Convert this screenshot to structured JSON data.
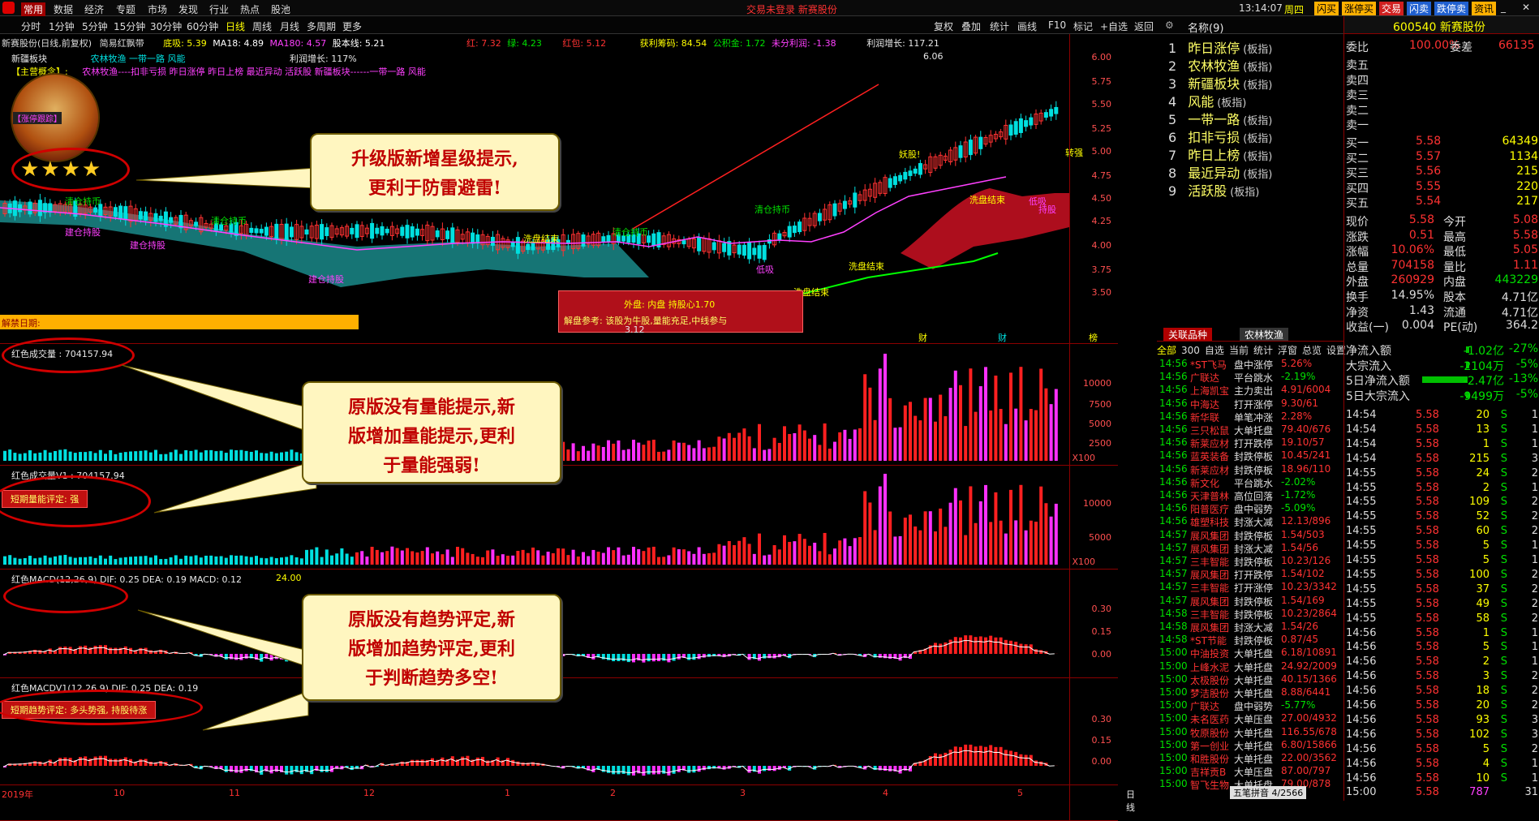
{
  "topbar": {
    "menu": [
      "常用",
      "数据",
      "经济",
      "专题",
      "市场",
      "发现",
      "行业",
      "热点",
      "股池"
    ],
    "center": "交易未登录   新赛股份",
    "time": "13:14:07",
    "weekday": "周四",
    "tabs": [
      "闪买",
      "涨停买",
      "交易",
      "闪卖",
      "跌停卖",
      "资讯"
    ]
  },
  "periods": {
    "items": [
      "分时",
      "1分钟",
      "5分钟",
      "15分钟",
      "30分钟",
      "60分钟",
      "日线",
      "周线",
      "月线",
      "多周期",
      "更多"
    ],
    "tools": [
      "复权",
      "叠加",
      "统计",
      "画线",
      "F10",
      "标记",
      "+自选",
      "返回"
    ]
  },
  "main": {
    "title": "新赛股份(日线,前复权)",
    "indicator": "简易红飘带",
    "ma": "MA18: 4.89",
    "ma180": "MA180: 4.57",
    "eq": "股本线: 5.21",
    "low": "底吸: 5.39",
    "red": "红: 7.32",
    "green": "绿: 4.23",
    "redpkg": "红包: 5.12",
    "chip": "获利筹码: 84.54",
    "gjj": "公积金: 1.72",
    "undist": "未分利润: -1.38",
    "profit": "利润增长: 117.21",
    "sector": "新疆板块",
    "concepts": "农林牧渔   一带一路 风能",
    "profit2": "利润增长:     117%",
    "main_concept": "【主营概念】:",
    "concept_line": "农林牧渔----扣非亏损 昨日涨停 昨日上榜 最近异动 活跃股 新疆板块------一带一路 风能",
    "zt": "【涨停跟踪】",
    "unlock": "解禁日期:",
    "yaxis": [
      "6.00",
      "5.75",
      "5.50",
      "5.25",
      "5.00",
      "4.75",
      "4.50",
      "4.25",
      "4.00",
      "3.75",
      "3.50"
    ],
    "peak": "6.06",
    "trough": "3.12",
    "inner": "外盘: 内盘    持股心1.70",
    "advice": "解盘参考: 该股为牛股,量能充足,中线参与",
    "labels": [
      "清仓持币",
      "清仓持币",
      "清仓持币",
      "清仓持币",
      "建仓持股",
      "建仓持股",
      "建仓持股",
      "洗盘结束",
      "洗盘结束",
      "洗盘结束",
      "洗盘结束",
      "妖股!",
      "转强",
      "持股",
      "低吸",
      "低吸"
    ],
    "markers": [
      "财",
      "财",
      "榜"
    ]
  },
  "vol1": {
    "title": "红色成交量 : 704157.94",
    "axis": [
      "10000",
      "7500",
      "5000",
      "2500"
    ],
    "unit": "X100"
  },
  "vol2": {
    "title": "红色成交量V1 : 704157.94",
    "tag": "短期量能评定: 强",
    "axis": [
      "10000",
      "5000"
    ],
    "unit": "X100"
  },
  "macd1": {
    "title": "红色MACD(12,26,9) DIF: 0.25  DEA: 0.19  MACD: 0.12",
    "extra": "24.00",
    "axis": [
      "0.30",
      "0.15",
      "0.00"
    ]
  },
  "macd2": {
    "title": "红色MACDV1(12,26,9) DIF: 0.25  DEA: 0.19",
    "tag": "短期趋势评定: 多头势强, 持股待涨",
    "axis": [
      "0.30",
      "0.15",
      "0.00"
    ]
  },
  "xaxis": [
    "2019年",
    "10",
    "11",
    "12",
    "1",
    "2",
    "3",
    "4",
    "5"
  ],
  "xaxis_end": "日线",
  "callouts": [
    "升级版新增星级提示,\n更利于防雷避雷!",
    "原版没有量能提示,新\n版增加量能提示,更利\n于量能强弱!",
    "原版没有趋势评定,新\n版增加趋势评定,更利\n于判断趋势多空!"
  ],
  "stars": "★★★★",
  "plates": {
    "header": "名称(9)",
    "items": [
      {
        "n": "1",
        "name": "昨日涨停",
        "tag": "(板指)"
      },
      {
        "n": "2",
        "name": "农林牧渔",
        "tag": "(板指)"
      },
      {
        "n": "3",
        "name": "新疆板块",
        "tag": "(板指)"
      },
      {
        "n": "4",
        "name": "风能",
        "tag": "(板指)"
      },
      {
        "n": "5",
        "name": "一带一路",
        "tag": "(板指)"
      },
      {
        "n": "6",
        "name": "扣非亏损",
        "tag": "(板指)"
      },
      {
        "n": "7",
        "name": "昨日上榜",
        "tag": "(板指)"
      },
      {
        "n": "8",
        "name": "最近异动",
        "tag": "(板指)"
      },
      {
        "n": "9",
        "name": "活跃股",
        "tag": "(板指)"
      }
    ],
    "tab1": "关联品种",
    "tab2": "农林牧渔"
  },
  "tickfilter": [
    "全部",
    "300",
    "自选",
    "当前",
    "统计",
    "浮窗",
    "总览",
    "设置"
  ],
  "ticks": [
    {
      "t": "14:56",
      "name": "*ST飞马",
      "ev": "盘中涨停",
      "v": "5.26%"
    },
    {
      "t": "14:56",
      "name": "广联达",
      "ev": "平台跳水",
      "v": "-2.19%"
    },
    {
      "t": "14:56",
      "name": "上海凯宝",
      "ev": "主力卖出",
      "v": "4.91/6004"
    },
    {
      "t": "14:56",
      "name": "中海达",
      "ev": "打开涨停",
      "v": "9.30/61"
    },
    {
      "t": "14:56",
      "name": "新华联",
      "ev": "单笔冲涨",
      "v": "2.28%"
    },
    {
      "t": "14:56",
      "name": "三只松鼠",
      "ev": "大单托盘",
      "v": "79.40/676"
    },
    {
      "t": "14:56",
      "name": "新莱应材",
      "ev": "打开跌停",
      "v": "19.10/57"
    },
    {
      "t": "14:56",
      "name": "蓝英装备",
      "ev": "封跌停板",
      "v": "10.45/241"
    },
    {
      "t": "14:56",
      "name": "新莱应材",
      "ev": "封跌停板",
      "v": "18.96/110"
    },
    {
      "t": "14:56",
      "name": "新文化",
      "ev": "平台跳水",
      "v": "-2.02%"
    },
    {
      "t": "14:56",
      "name": "天津普林",
      "ev": "高位回落",
      "v": "-1.72%"
    },
    {
      "t": "14:56",
      "name": "阳普医疗",
      "ev": "盘中弱势",
      "v": "-5.09%"
    },
    {
      "t": "14:56",
      "name": "雄塑科技",
      "ev": "封涨大减",
      "v": "12.13/896"
    },
    {
      "t": "14:57",
      "name": "展风集团",
      "ev": "封跌停板",
      "v": "1.54/503"
    },
    {
      "t": "14:57",
      "name": "展风集团",
      "ev": "封涨大减",
      "v": "1.54/56"
    },
    {
      "t": "14:57",
      "name": "三丰智能",
      "ev": "封跌停板",
      "v": "10.23/126"
    },
    {
      "t": "14:57",
      "name": "展风集团",
      "ev": "打开跌停",
      "v": "1.54/102"
    },
    {
      "t": "14:57",
      "name": "三丰智能",
      "ev": "打开涨停",
      "v": "10.23/3342"
    },
    {
      "t": "14:57",
      "name": "展风集团",
      "ev": "封跌停板",
      "v": "1.54/169"
    },
    {
      "t": "14:58",
      "name": "三丰智能",
      "ev": "封跌停板",
      "v": "10.23/2864"
    },
    {
      "t": "14:58",
      "name": "展风集团",
      "ev": "封涨大减",
      "v": "1.54/26"
    },
    {
      "t": "14:58",
      "name": "*ST节能",
      "ev": "封跌停板",
      "v": "0.87/45"
    },
    {
      "t": "15:00",
      "name": "中油投资",
      "ev": "大单托盘",
      "v": "6.18/10891"
    },
    {
      "t": "15:00",
      "name": "上峰水泥",
      "ev": "大单托盘",
      "v": "24.92/2009"
    },
    {
      "t": "15:00",
      "name": "太极股份",
      "ev": "大单托盘",
      "v": "40.15/1366"
    },
    {
      "t": "15:00",
      "name": "梦洁股份",
      "ev": "大单托盘",
      "v": "8.88/6441"
    },
    {
      "t": "15:00",
      "name": "广联达",
      "ev": "盘中弱势",
      "v": "-5.77%"
    },
    {
      "t": "15:00",
      "name": "未名医药",
      "ev": "大单压盘",
      "v": "27.00/4932"
    },
    {
      "t": "15:00",
      "name": "牧原股份",
      "ev": "大单托盘",
      "v": "116.55/678"
    },
    {
      "t": "15:00",
      "name": "第一创业",
      "ev": "大单托盘",
      "v": "6.80/15866"
    },
    {
      "t": "15:00",
      "name": "和胜股份",
      "ev": "大单托盘",
      "v": "22.00/3562"
    },
    {
      "t": "15:00",
      "name": "吉祥贡B",
      "ev": "大单压盘",
      "v": "87.00/797"
    },
    {
      "t": "15:00",
      "name": "智飞生物",
      "ev": "大单托盘",
      "v": "79.00/878"
    }
  ],
  "tickfoot": "五笔拼音    4/2566",
  "quote": {
    "code": "600540 新赛股份",
    "weibi": "委比",
    "weibi_v": "100.00%",
    "weicha": "委差",
    "weicha_v": "66135",
    "asks": [
      "卖五",
      "卖四",
      "卖三",
      "卖二",
      "卖一"
    ],
    "bids": [
      {
        "l": "买一",
        "p": "5.58",
        "v": "64349"
      },
      {
        "l": "买二",
        "p": "5.57",
        "v": "1134"
      },
      {
        "l": "买三",
        "p": "5.56",
        "v": "215"
      },
      {
        "l": "买四",
        "p": "5.55",
        "v": "220"
      },
      {
        "l": "买五",
        "p": "5.54",
        "v": "217"
      }
    ],
    "stats": [
      {
        "a": "现价",
        "av": "5.58",
        "b": "今开",
        "bv": "5.08"
      },
      {
        "a": "涨跌",
        "av": "0.51",
        "b": "最高",
        "bv": "5.58"
      },
      {
        "a": "涨幅",
        "av": "10.06%",
        "b": "最低",
        "bv": "5.05"
      },
      {
        "a": "总量",
        "av": "704158",
        "b": "量比",
        "bv": "1.11"
      },
      {
        "a": "外盘",
        "av": "260929",
        "b": "内盘",
        "bv": "443229"
      },
      {
        "a": "换手",
        "av": "14.95%",
        "b": "股本",
        "bv": "4.71亿"
      },
      {
        "a": "净资",
        "av": "1.43",
        "b": "流通",
        "bv": "4.71亿"
      },
      {
        "a": "收益(一)",
        "av": "0.004",
        "b": "PE(动)",
        "bv": "364.2"
      }
    ],
    "flows": [
      {
        "l": "净流入额",
        "v": "-1.02亿",
        "p": "-27%"
      },
      {
        "l": "大宗流入",
        "v": "-2104万",
        "p": "-5%"
      },
      {
        "l": "5日净流入额",
        "v": "-2.47亿",
        "p": "-13%"
      },
      {
        "l": "5日大宗流入",
        "v": "-9499万",
        "p": "-5%"
      }
    ],
    "trades": [
      {
        "t": "14:54",
        "p": "5.58",
        "v": "20",
        "s": "S",
        "n": "1"
      },
      {
        "t": "14:54",
        "p": "5.58",
        "v": "13",
        "s": "S",
        "n": "1"
      },
      {
        "t": "14:54",
        "p": "5.58",
        "v": "1",
        "s": "S",
        "n": "1"
      },
      {
        "t": "14:54",
        "p": "5.58",
        "v": "215",
        "s": "S",
        "n": "3"
      },
      {
        "t": "14:55",
        "p": "5.58",
        "v": "24",
        "s": "S",
        "n": "2"
      },
      {
        "t": "14:55",
        "p": "5.58",
        "v": "2",
        "s": "S",
        "n": "1"
      },
      {
        "t": "14:55",
        "p": "5.58",
        "v": "109",
        "s": "S",
        "n": "2"
      },
      {
        "t": "14:55",
        "p": "5.58",
        "v": "52",
        "s": "S",
        "n": "2"
      },
      {
        "t": "14:55",
        "p": "5.58",
        "v": "60",
        "s": "S",
        "n": "2"
      },
      {
        "t": "14:55",
        "p": "5.58",
        "v": "5",
        "s": "S",
        "n": "1"
      },
      {
        "t": "14:55",
        "p": "5.58",
        "v": "5",
        "s": "S",
        "n": "1"
      },
      {
        "t": "14:55",
        "p": "5.58",
        "v": "100",
        "s": "S",
        "n": "2"
      },
      {
        "t": "14:55",
        "p": "5.58",
        "v": "37",
        "s": "S",
        "n": "2"
      },
      {
        "t": "14:55",
        "p": "5.58",
        "v": "49",
        "s": "S",
        "n": "2"
      },
      {
        "t": "14:55",
        "p": "5.58",
        "v": "58",
        "s": "S",
        "n": "2"
      },
      {
        "t": "14:56",
        "p": "5.58",
        "v": "1",
        "s": "S",
        "n": "1"
      },
      {
        "t": "14:56",
        "p": "5.58",
        "v": "5",
        "s": "S",
        "n": "1"
      },
      {
        "t": "14:56",
        "p": "5.58",
        "v": "2",
        "s": "S",
        "n": "1"
      },
      {
        "t": "14:56",
        "p": "5.58",
        "v": "3",
        "s": "S",
        "n": "2"
      },
      {
        "t": "14:56",
        "p": "5.58",
        "v": "18",
        "s": "S",
        "n": "2"
      },
      {
        "t": "14:56",
        "p": "5.58",
        "v": "20",
        "s": "S",
        "n": "2"
      },
      {
        "t": "14:56",
        "p": "5.58",
        "v": "93",
        "s": "S",
        "n": "3"
      },
      {
        "t": "14:56",
        "p": "5.58",
        "v": "102",
        "s": "S",
        "n": "3"
      },
      {
        "t": "14:56",
        "p": "5.58",
        "v": "5",
        "s": "S",
        "n": "2"
      },
      {
        "t": "14:56",
        "p": "5.58",
        "v": "4",
        "s": "S",
        "n": "1"
      },
      {
        "t": "14:56",
        "p": "5.58",
        "v": "10",
        "s": "S",
        "n": "1"
      },
      {
        "t": "15:00",
        "p": "5.58",
        "v": "787",
        "s": "",
        "n": "31"
      }
    ]
  },
  "colors": {
    "up": "#ff3232",
    "down": "#00e0e0",
    "bg": "#000000",
    "panel_border": "#8b0000",
    "ribbon": "#c01020",
    "cyan_band": "#1a8a8a"
  }
}
